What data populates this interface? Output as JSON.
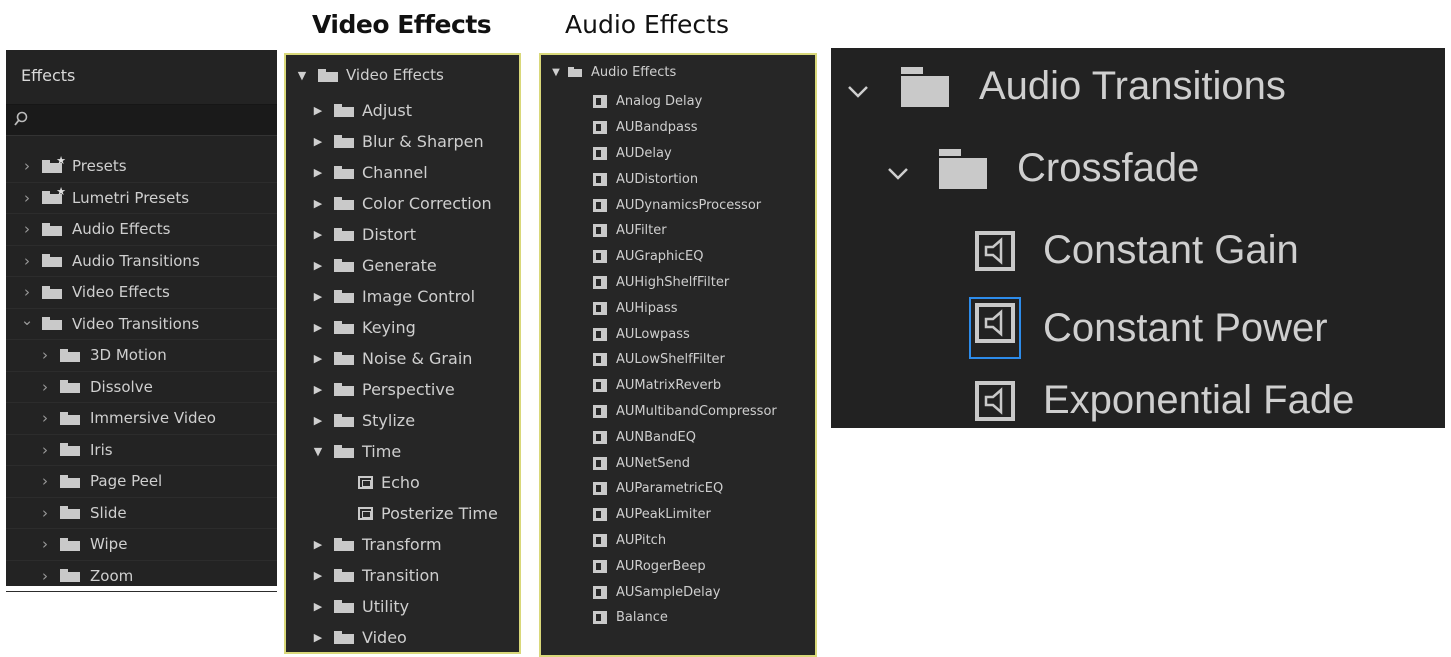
{
  "captions": {
    "video_effects": "Video Effects",
    "audio_effects": "Audio Effects"
  },
  "effects_panel": {
    "title": "Effects",
    "search_placeholder": "",
    "items": [
      {
        "label": "Presets",
        "icon": "preset-folder-icon",
        "expanded": false,
        "level": 0
      },
      {
        "label": "Lumetri Presets",
        "icon": "preset-folder-icon",
        "expanded": false,
        "level": 0
      },
      {
        "label": "Audio Effects",
        "icon": "folder-icon",
        "expanded": false,
        "level": 0
      },
      {
        "label": "Audio Transitions",
        "icon": "folder-icon",
        "expanded": false,
        "level": 0
      },
      {
        "label": "Video Effects",
        "icon": "folder-icon",
        "expanded": false,
        "level": 0
      },
      {
        "label": "Video Transitions",
        "icon": "folder-icon",
        "expanded": true,
        "level": 0
      },
      {
        "label": "3D Motion",
        "icon": "folder-icon",
        "expanded": false,
        "level": 1
      },
      {
        "label": "Dissolve",
        "icon": "folder-icon",
        "expanded": false,
        "level": 1
      },
      {
        "label": "Immersive Video",
        "icon": "folder-icon",
        "expanded": false,
        "level": 1
      },
      {
        "label": "Iris",
        "icon": "folder-icon",
        "expanded": false,
        "level": 1
      },
      {
        "label": "Page Peel",
        "icon": "folder-icon",
        "expanded": false,
        "level": 1
      },
      {
        "label": "Slide",
        "icon": "folder-icon",
        "expanded": false,
        "level": 1
      },
      {
        "label": "Wipe",
        "icon": "folder-icon",
        "expanded": false,
        "level": 1
      },
      {
        "label": "Zoom",
        "icon": "folder-icon",
        "expanded": false,
        "level": 1
      }
    ]
  },
  "video_effects_panel": {
    "root": "Video Effects",
    "items": [
      {
        "label": "Adjust",
        "type": "folder",
        "expanded": false,
        "level": 1
      },
      {
        "label": "Blur & Sharpen",
        "type": "folder",
        "expanded": false,
        "level": 1
      },
      {
        "label": "Channel",
        "type": "folder",
        "expanded": false,
        "level": 1
      },
      {
        "label": "Color Correction",
        "type": "folder",
        "expanded": false,
        "level": 1
      },
      {
        "label": "Distort",
        "type": "folder",
        "expanded": false,
        "level": 1
      },
      {
        "label": "Generate",
        "type": "folder",
        "expanded": false,
        "level": 1
      },
      {
        "label": "Image Control",
        "type": "folder",
        "expanded": false,
        "level": 1
      },
      {
        "label": "Keying",
        "type": "folder",
        "expanded": false,
        "level": 1
      },
      {
        "label": "Noise & Grain",
        "type": "folder",
        "expanded": false,
        "level": 1
      },
      {
        "label": "Perspective",
        "type": "folder",
        "expanded": false,
        "level": 1
      },
      {
        "label": "Stylize",
        "type": "folder",
        "expanded": false,
        "level": 1
      },
      {
        "label": "Time",
        "type": "folder",
        "expanded": true,
        "level": 1
      },
      {
        "label": "Echo",
        "type": "effect",
        "level": 2
      },
      {
        "label": "Posterize Time",
        "type": "effect",
        "level": 2
      },
      {
        "label": "Transform",
        "type": "folder",
        "expanded": false,
        "level": 1
      },
      {
        "label": "Transition",
        "type": "folder",
        "expanded": false,
        "level": 1
      },
      {
        "label": "Utility",
        "type": "folder",
        "expanded": false,
        "level": 1
      },
      {
        "label": "Video",
        "type": "folder",
        "expanded": false,
        "level": 1
      }
    ]
  },
  "audio_effects_panel": {
    "root": "Audio Effects",
    "items": [
      "Analog Delay",
      "AUBandpass",
      "AUDelay",
      "AUDistortion",
      "AUDynamicsProcessor",
      "AUFilter",
      "AUGraphicEQ",
      "AUHighShelfFilter",
      "AUHipass",
      "AULowpass",
      "AULowShelfFilter",
      "AUMatrixReverb",
      "AUMultibandCompressor",
      "AUNBandEQ",
      "AUNetSend",
      "AUParametricEQ",
      "AUPeakLimiter",
      "AUPitch",
      "AURogerBeep",
      "AUSampleDelay",
      "Balance"
    ]
  },
  "audio_transitions_zoom": {
    "root": "Audio Transitions",
    "folder": "Crossfade",
    "items": [
      {
        "label": "Constant Gain",
        "selected": false
      },
      {
        "label": "Constant Power",
        "selected": true
      },
      {
        "label": "Exponential Fade",
        "selected": false
      }
    ]
  },
  "colors": {
    "panel_bg": "#232323",
    "highlight_border": "#d9d87a",
    "selection_border": "#2d8ceb",
    "text": "#cfcfcf"
  }
}
